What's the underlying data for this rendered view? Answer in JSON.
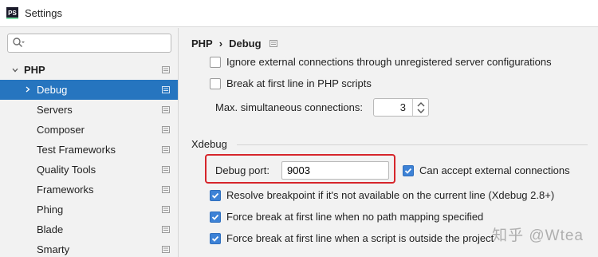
{
  "window": {
    "title": "Settings",
    "app_icon_text": "PS"
  },
  "sidebar": {
    "search_placeholder": "",
    "root": {
      "label": "PHP"
    },
    "items": [
      {
        "label": "Debug",
        "selected": true
      },
      {
        "label": "Servers"
      },
      {
        "label": "Composer"
      },
      {
        "label": "Test Frameworks"
      },
      {
        "label": "Quality Tools"
      },
      {
        "label": "Frameworks"
      },
      {
        "label": "Phing"
      },
      {
        "label": "Blade"
      },
      {
        "label": "Smarty"
      }
    ]
  },
  "content": {
    "breadcrumb": {
      "parent": "PHP",
      "separator": "›",
      "current": "Debug"
    },
    "options": {
      "ignore_external": {
        "label": "Ignore external connections through unregistered server configurations",
        "checked": false
      },
      "break_first_line": {
        "label": "Break at first line in PHP scripts",
        "checked": false
      },
      "max_connections": {
        "label": "Max. simultaneous connections:",
        "value": "3"
      }
    },
    "xdebug": {
      "section_title": "Xdebug",
      "debug_port_label": "Debug port:",
      "debug_port_value": "9003",
      "can_accept_external": {
        "label": "Can accept external connections",
        "checked": true
      },
      "resolve_breakpoint": {
        "label": "Resolve breakpoint if it's not available on the current line (Xdebug 2.8+)",
        "checked": true
      },
      "force_break_no_mapping": {
        "label": "Force break at first line when no path mapping specified",
        "checked": true
      },
      "force_break_outside": {
        "label": "Force break at first line when a script is outside the project",
        "checked": true
      }
    }
  },
  "watermark": "知乎 @Wtea",
  "colors": {
    "selection": "#2675bf",
    "checkbox_checked": "#3d82d6",
    "highlight": "#d6252b"
  }
}
